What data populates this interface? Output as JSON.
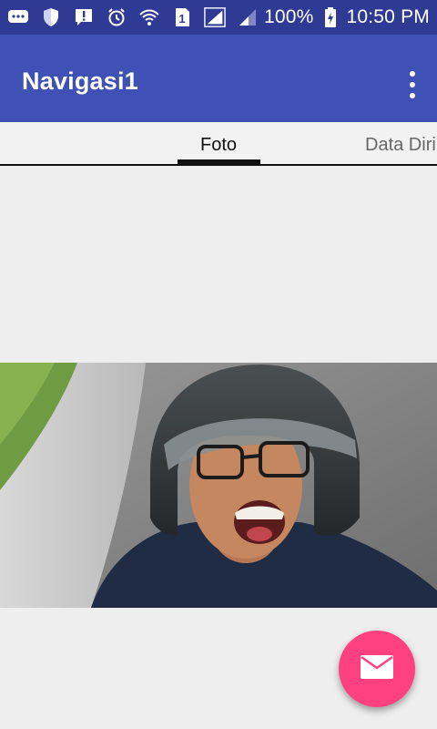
{
  "status_bar": {
    "battery": "100%",
    "time": "10:50 PM",
    "sim_slot": "1",
    "icons": [
      "messages-icon",
      "shield-icon",
      "alert-message-icon",
      "alarm-icon",
      "wifi-icon",
      "sim-1-icon",
      "signal-icon",
      "signal-weak-icon",
      "battery-charging-icon"
    ]
  },
  "app_bar": {
    "title": "Navigasi1",
    "menu_icon": "overflow-menu-icon"
  },
  "tabs": [
    {
      "label": "Foto",
      "selected": true
    },
    {
      "label": "Data Diri",
      "selected": false
    }
  ],
  "fab": {
    "icon": "email-icon",
    "color": "#ff4081"
  },
  "colors": {
    "status_bar": "#2e3a93",
    "app_bar": "#3f51b5",
    "background": "#eeeeee"
  }
}
